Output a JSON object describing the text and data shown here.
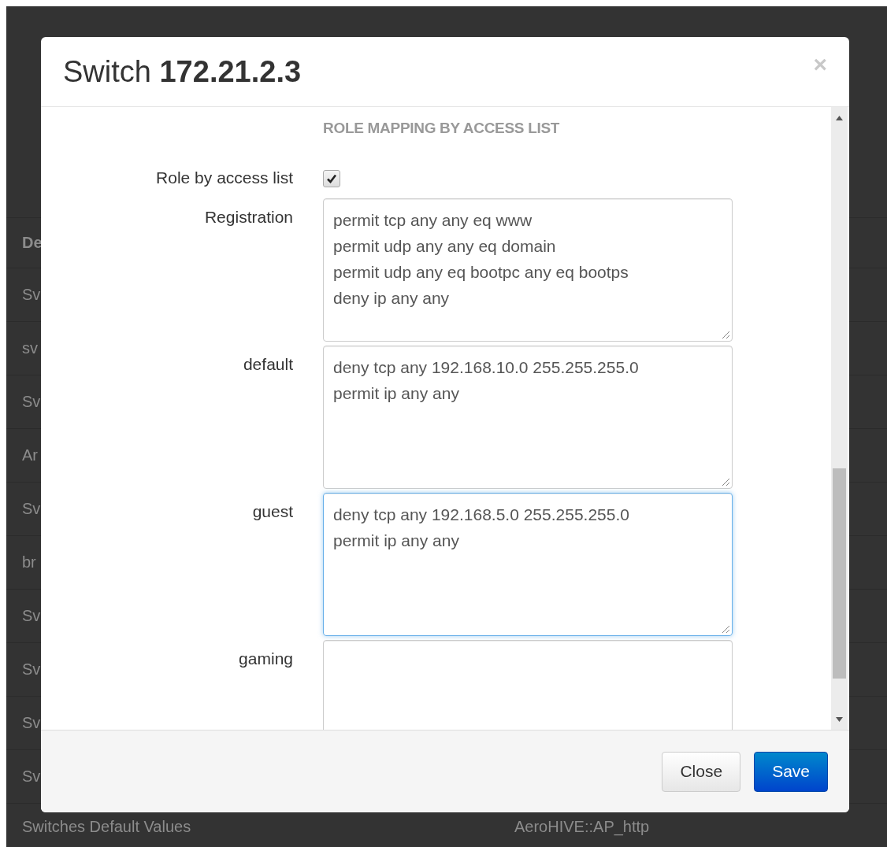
{
  "background_table": {
    "header": "De",
    "rows": [
      "Sv",
      "sv",
      "Sv",
      "Ar",
      "Sv",
      "br",
      "Sv",
      "Sv",
      "Sv",
      "Sv"
    ],
    "last_row": {
      "description": "Switches Default Values",
      "column_2": "AeroHIVE::AP_http"
    }
  },
  "dialog": {
    "title": "Switch",
    "title_bold": "172.21.2.3",
    "close": "×",
    "section": "ROLE MAPPING BY ACCESS LIST",
    "fields": [
      {
        "kind": "checkbox",
        "label": "Role by access list",
        "checked": true
      },
      {
        "kind": "textarea",
        "label": "Registration",
        "value": "permit tcp any any eq www\npermit udp any any eq domain\npermit udp any eq bootpc any eq bootps\ndeny ip any any",
        "focused": false
      },
      {
        "kind": "textarea",
        "label": "default",
        "value": "deny tcp any 192.168.10.0 255.255.255.0\npermit ip any any",
        "focused": false
      },
      {
        "kind": "textarea",
        "label": "guest",
        "value": "deny tcp any 192.168.5.0 255.255.255.0\npermit ip any any",
        "focused": true
      },
      {
        "kind": "textarea",
        "label": "gaming",
        "focused": false
      }
    ],
    "buttons": [
      {
        "label": "Close",
        "kind": "default"
      },
      {
        "label": "Save",
        "kind": "primary"
      }
    ]
  }
}
